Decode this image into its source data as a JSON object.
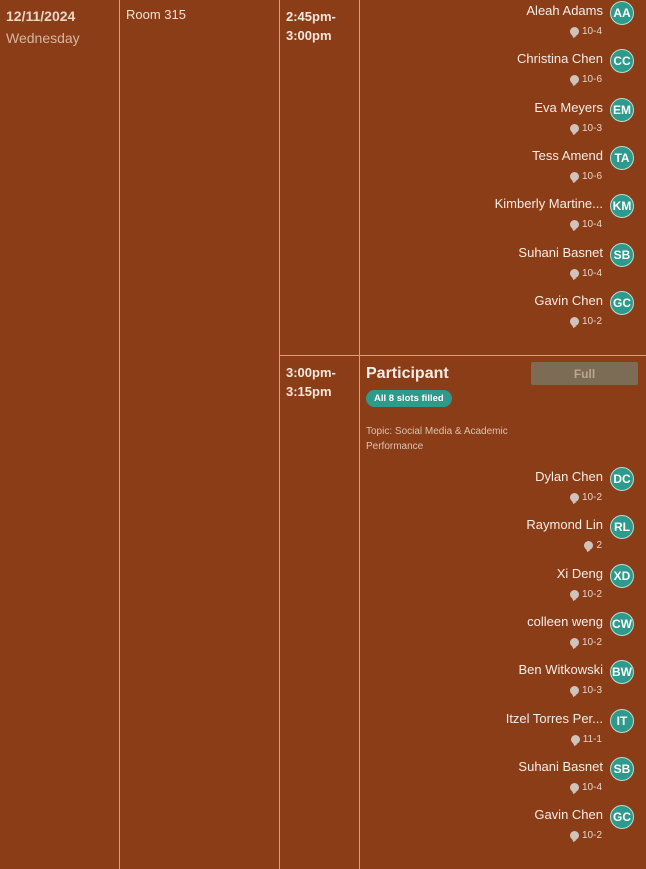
{
  "date": "12/11/2024",
  "weekday": "Wednesday",
  "room": "Room 315",
  "slots": [
    {
      "time": [
        "2:45pm-",
        "3:00pm"
      ],
      "participants": [
        {
          "name": "Aleah Adams",
          "grade": "10-4",
          "initials": "AA"
        },
        {
          "name": "Christina Chen",
          "grade": "10-6",
          "initials": "CC"
        },
        {
          "name": "Eva Meyers",
          "grade": "10-3",
          "initials": "EM"
        },
        {
          "name": "Tess Amend",
          "grade": "10-6",
          "initials": "TA"
        },
        {
          "name": "Kimberly Martine...",
          "grade": "10-4",
          "initials": "KM"
        },
        {
          "name": "Suhani Basnet",
          "grade": "10-4",
          "initials": "SB"
        },
        {
          "name": "Gavin Chen",
          "grade": "10-2",
          "initials": "GC"
        }
      ]
    },
    {
      "time": [
        "3:00pm-",
        "3:15pm"
      ],
      "title": "Participant",
      "button": "Full",
      "badge": "All 8 slots filled",
      "topic": "Topic: Social Media & Academic Performance",
      "participants": [
        {
          "name": "Dylan Chen",
          "grade": "10-2",
          "initials": "DC"
        },
        {
          "name": "Raymond Lin",
          "grade": "2",
          "initials": "RL"
        },
        {
          "name": "Xi Deng",
          "grade": "10-2",
          "initials": "XD"
        },
        {
          "name": "colleen weng",
          "grade": "10-2",
          "initials": "CW"
        },
        {
          "name": "Ben Witkowski",
          "grade": "10-3",
          "initials": "BW"
        },
        {
          "name": "Itzel Torres Per...",
          "grade": "11-1",
          "initials": "IT"
        },
        {
          "name": "Suhani Basnet",
          "grade": "10-4",
          "initials": "SB"
        },
        {
          "name": "Gavin Chen",
          "grade": "10-2",
          "initials": "GC"
        }
      ]
    }
  ],
  "colors": {
    "background": "#8b3d18",
    "avatar": "#2e9a8c",
    "badge": "#2e9a8c",
    "full_button": "#7c6b55"
  },
  "icons": {
    "grade": "speech-bubble-icon"
  }
}
